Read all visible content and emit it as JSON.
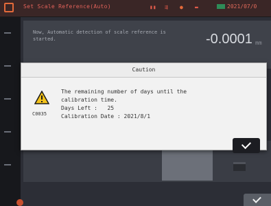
{
  "topbar": {
    "title": "Set Scale Reference(Auto)",
    "status_icons": [
      "signal-icon",
      "wireless-icon",
      "alert-icon",
      "battery-icon"
    ],
    "date": "2021/07/0"
  },
  "background": {
    "message": "Now, Automatic detection of scale reference is started.",
    "value": "-0.0001",
    "unit": "mm"
  },
  "dialog": {
    "title": "Caution",
    "error_code": "C0035",
    "message_line1": "The remaining number of days until the",
    "message_line2": "calibration time.",
    "days_left_label": "Days Left :",
    "days_left_value": "25",
    "calibration_date_label": "Calibration Date :",
    "calibration_date_value": "2021/8/1",
    "ok_icon": "check-icon"
  },
  "colors": {
    "accent": "#e2625a",
    "warning": "#f3c21b",
    "dialog_bg": "#f2f2f2",
    "ok_button": "#1c1d22"
  }
}
